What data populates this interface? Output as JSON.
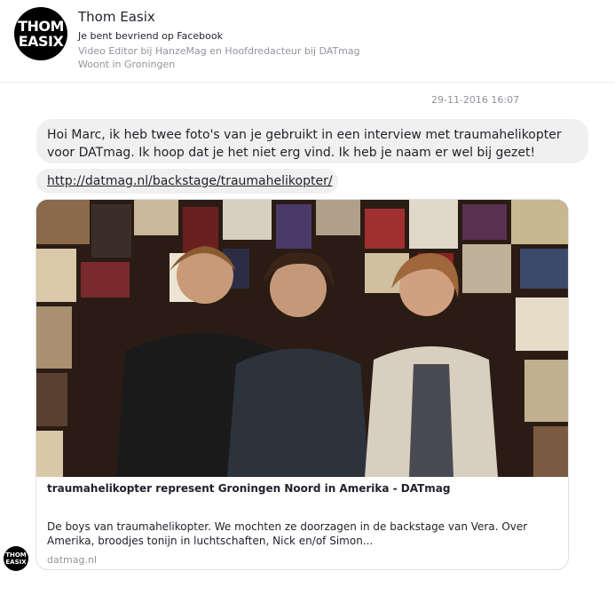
{
  "header": {
    "avatar_line1": "THOM",
    "avatar_line2": "EASIX",
    "name": "Thom Easix",
    "friend_status": "Je bent bevriend op Facebook",
    "work": "Video Editor bij HanzeMag en Hoofdredacteur bij DATmag",
    "lives": "Woont in Groningen"
  },
  "conversation": {
    "timestamp": "29-11-2016 16:07",
    "message_text": "Hoi Marc, ik heb twee foto's van je gebruikt in een interview met traumahelikopter voor DATmag. Ik hoop dat je het niet erg vind. Ik heb je naam er wel bij gezet!",
    "link_text": "http://datmag.nl/backstage/traumahelikopter/",
    "link_card": {
      "title": "traumahelikopter represent Groningen Noord in Amerika - DATmag",
      "description": "De boys van traumahelikopter. We mochten ze doorzagen in de backstage van Vera. Over Amerika, broodjes tonijn in luchtschaften, Nick en/of Simon...",
      "domain": "datmag.nl"
    },
    "sender_avatar_line1": "THOM",
    "sender_avatar_line2": "EASIX"
  }
}
